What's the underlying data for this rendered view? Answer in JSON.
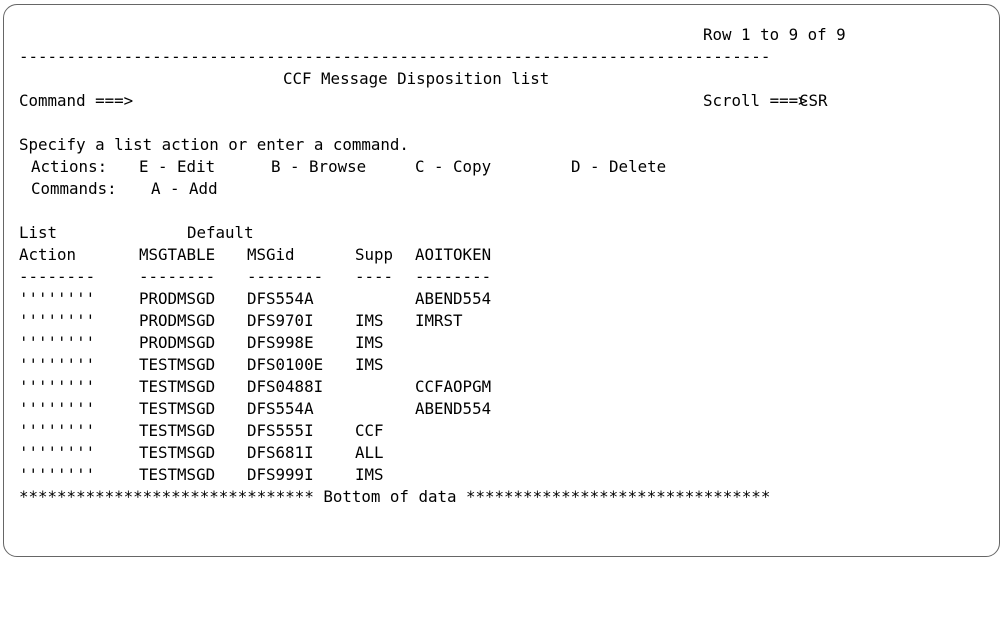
{
  "header": {
    "row_info": "Row 1 to 9 of 9",
    "separator": "-------------------------------------------------------------------------------",
    "title": "CCF Message Disposition list",
    "command_label": "Command ===>",
    "scroll_label": "Scroll ===>",
    "scroll_value": "CSR"
  },
  "instructions": {
    "prompt": "Specify a list action or enter a command.",
    "actions_label": "Actions:",
    "actions": [
      "E - Edit",
      "B - Browse",
      "C - Copy",
      "D - Delete"
    ],
    "commands_label": "Commands:",
    "commands": [
      "A - Add"
    ]
  },
  "table": {
    "header_row1": {
      "list": "List",
      "default": "Default"
    },
    "header_row2": {
      "action": "Action",
      "msgtable": "MSGTABLE",
      "msgid": "MSGid",
      "supp": "Supp",
      "aoitoken": "AOITOKEN"
    },
    "underlines": {
      "action": "--------",
      "msgtable": "--------",
      "msgid": "--------",
      "supp": "----",
      "aoitoken": "--------"
    },
    "rows": [
      {
        "action": "''''''''",
        "msgtable": "PRODMSGD",
        "msgid": "DFS554A",
        "supp": "",
        "aoitoken": "ABEND554"
      },
      {
        "action": "''''''''",
        "msgtable": "PRODMSGD",
        "msgid": "DFS970I",
        "supp": "IMS",
        "aoitoken": "IMRST"
      },
      {
        "action": "''''''''",
        "msgtable": "PRODMSGD",
        "msgid": "DFS998E",
        "supp": "IMS",
        "aoitoken": ""
      },
      {
        "action": "''''''''",
        "msgtable": "TESTMSGD",
        "msgid": "DFS0100E",
        "supp": "IMS",
        "aoitoken": ""
      },
      {
        "action": "''''''''",
        "msgtable": "TESTMSGD",
        "msgid": "DFS0488I",
        "supp": "",
        "aoitoken": "CCFAOPGM"
      },
      {
        "action": "''''''''",
        "msgtable": "TESTMSGD",
        "msgid": "DFS554A",
        "supp": "",
        "aoitoken": "ABEND554"
      },
      {
        "action": "''''''''",
        "msgtable": "TESTMSGD",
        "msgid": "DFS555I",
        "supp": "CCF",
        "aoitoken": ""
      },
      {
        "action": "''''''''",
        "msgtable": "TESTMSGD",
        "msgid": "DFS681I",
        "supp": "ALL",
        "aoitoken": ""
      },
      {
        "action": "''''''''",
        "msgtable": "TESTMSGD",
        "msgid": "DFS999I",
        "supp": "IMS",
        "aoitoken": ""
      }
    ],
    "footer": "******************************* Bottom of data ********************************"
  }
}
